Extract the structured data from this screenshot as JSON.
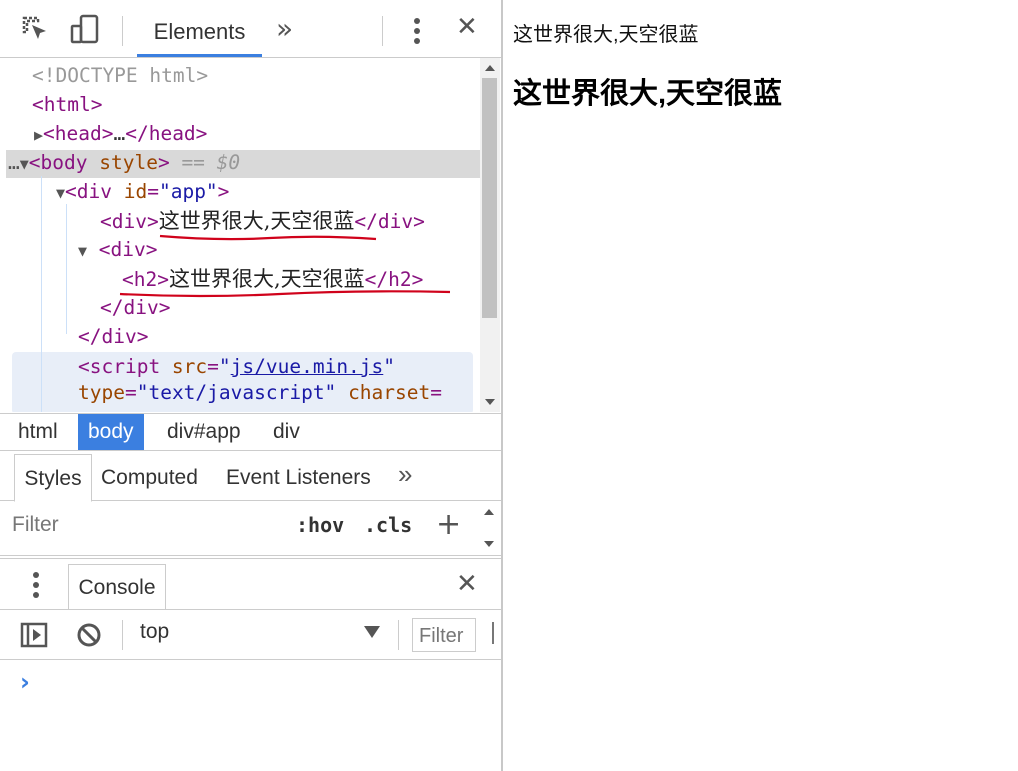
{
  "toolbar": {
    "elements_tab": "Elements",
    "more_tabs": "»",
    "close": "✕"
  },
  "tree": {
    "doctype": "<!DOCTYPE html>",
    "lines": [
      {
        "open": "<html>"
      },
      {
        "open": "<head>",
        "ellipsis": "…",
        "close": "</head>"
      },
      {
        "eq": "== $0"
      },
      {
        "id_value": "\"app\""
      },
      {
        "text": "这世界很大,天空很蓝"
      },
      {
        "h2_text": "这世界很大,天空很蓝"
      }
    ],
    "script": {
      "src_value": "js/vue.min.js",
      "type_value": "\"text/javascript\""
    }
  },
  "breadcrumbs": [
    "html",
    "body",
    "div#app",
    "div"
  ],
  "styles_tabs": [
    "Styles",
    "Computed",
    "Event Listeners"
  ],
  "styles_filter": {
    "placeholder": "Filter",
    "hov": ":hov",
    "cls": ".cls",
    "add": "+"
  },
  "drawer": {
    "console_tab": "Console",
    "context": "top",
    "filter_placeholder": "Filter",
    "prompt": "›"
  },
  "page": {
    "div_text": "这世界很大,天空很蓝",
    "h2_text": "这世界很大,天空很蓝"
  },
  "colors": {
    "accent": "#3b7fe0",
    "annotation": "#d0021b"
  }
}
